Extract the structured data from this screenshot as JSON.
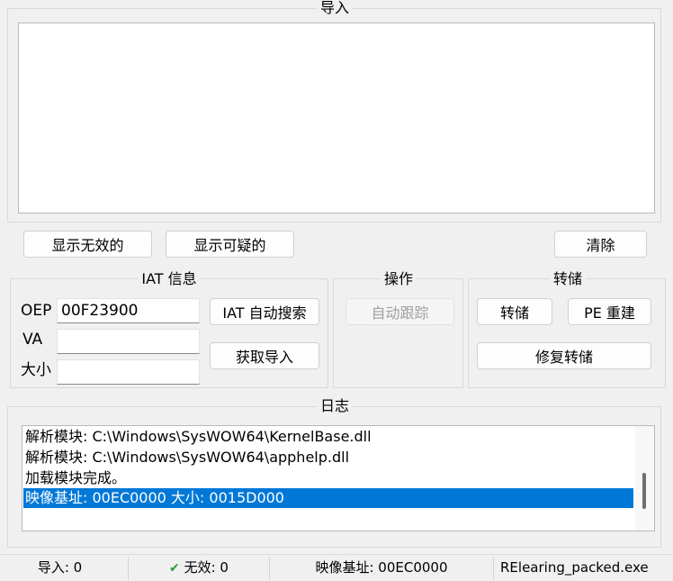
{
  "imports": {
    "title": "导入",
    "show_invalid": "显示无效的",
    "show_suspect": "显示可疑的",
    "clear": "清除"
  },
  "iat": {
    "title": "IAT 信息",
    "oep_label": "OEP",
    "oep_value": "00F23900",
    "va_label": "VA",
    "va_value": "",
    "size_label": "大小",
    "size_value": "",
    "autosearch": "IAT 自动搜索",
    "get_imports": "获取导入"
  },
  "actions": {
    "title": "操作",
    "autotrace": "自动跟踪"
  },
  "dump": {
    "title": "转储",
    "dump": "转储",
    "pe_rebuild": "PE 重建",
    "fix_dump": "修复转储"
  },
  "log": {
    "title": "日志",
    "lines": [
      "解析模块: C:\\Windows\\SysWOW64\\KernelBase.dll",
      "解析模块: C:\\Windows\\SysWOW64\\apphelp.dll",
      "加载模块完成。",
      "映像基址: 00EC0000 大小: 0015D000"
    ]
  },
  "statusbar": {
    "imports": "导入: 0",
    "invalid": "无效: 0",
    "imagebase": "映像基址: 00EC0000",
    "process": "RElearing_packed.exe"
  },
  "colors": {
    "selection": "#0078d7",
    "check": "#2e9b3a"
  }
}
